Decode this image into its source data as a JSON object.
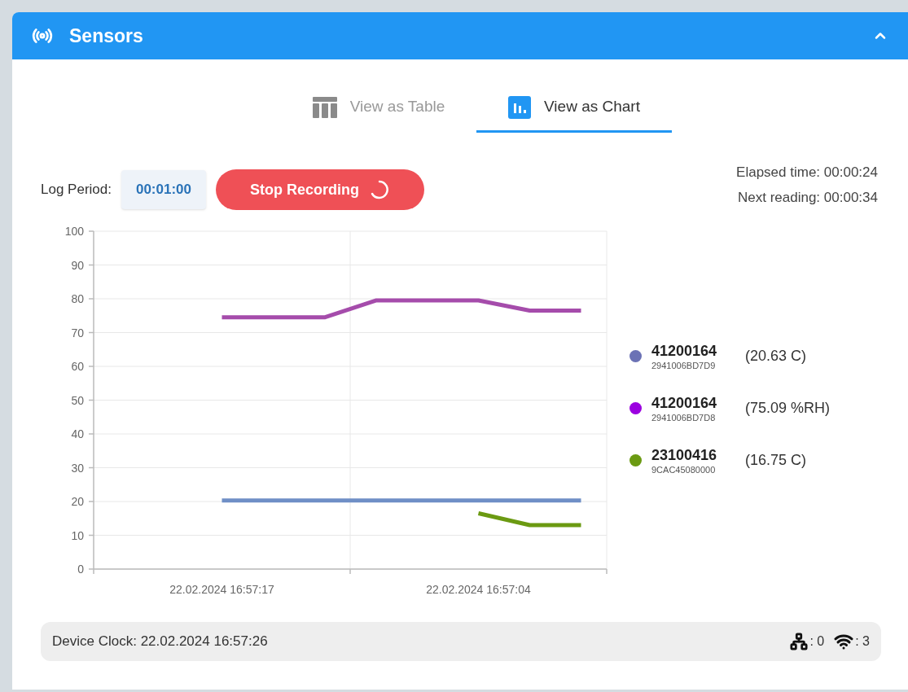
{
  "panel": {
    "title": "Sensors",
    "expanded": true
  },
  "tabs": [
    {
      "label": "View as Table",
      "kind": "table",
      "selected": false
    },
    {
      "label": "View as Chart",
      "kind": "chart",
      "selected": true
    }
  ],
  "log_period": {
    "label": "Log Period:",
    "value": "00:01:00"
  },
  "record_button": {
    "label": "Stop Recording",
    "busy": true
  },
  "elapsed": "Elapsed time: 00:00:24",
  "next_reading": "Next reading: 00:00:34",
  "chart_data": {
    "type": "line",
    "grid": true,
    "categories": [
      null,
      null,
      "22.02.2024 16:57:17",
      null,
      null,
      null,
      null,
      "22.02.2024 16:57:04",
      null,
      null
    ],
    "ylim": [
      0,
      100
    ],
    "yticks": [
      0,
      10,
      20,
      30,
      40,
      50,
      60,
      70,
      80,
      90,
      100
    ],
    "series": [
      {
        "color": "#6f8fc6",
        "values": [
          null,
          null,
          20.3,
          20.3,
          20.3,
          20.3,
          20.3,
          20.3,
          20.3,
          20.3
        ]
      },
      {
        "color": "#a54cab",
        "values": [
          null,
          null,
          74.5,
          74.5,
          74.5,
          79.5,
          79.5,
          79.5,
          76.5,
          76.5
        ]
      },
      {
        "color": "#6b9a12",
        "values": [
          null,
          null,
          null,
          null,
          null,
          null,
          null,
          16.5,
          13,
          13
        ]
      }
    ]
  },
  "legend": [
    {
      "name": "41200164",
      "id": "2941006BD7D9",
      "reading": "(20.63 C)",
      "color": "#6b72b5"
    },
    {
      "name": "41200164",
      "id": "2941006BD7D8",
      "reading": "(75.09 %RH)",
      "color": "#9b00e0"
    },
    {
      "name": "23100416",
      "id": "9CAC45080000",
      "reading": "(16.75 C)",
      "color": "#6b9a12"
    }
  ],
  "status_bar": {
    "clock": "Device Clock: 22.02.2024 16:57:26",
    "wired": ": 0",
    "wireless": ": 3"
  }
}
